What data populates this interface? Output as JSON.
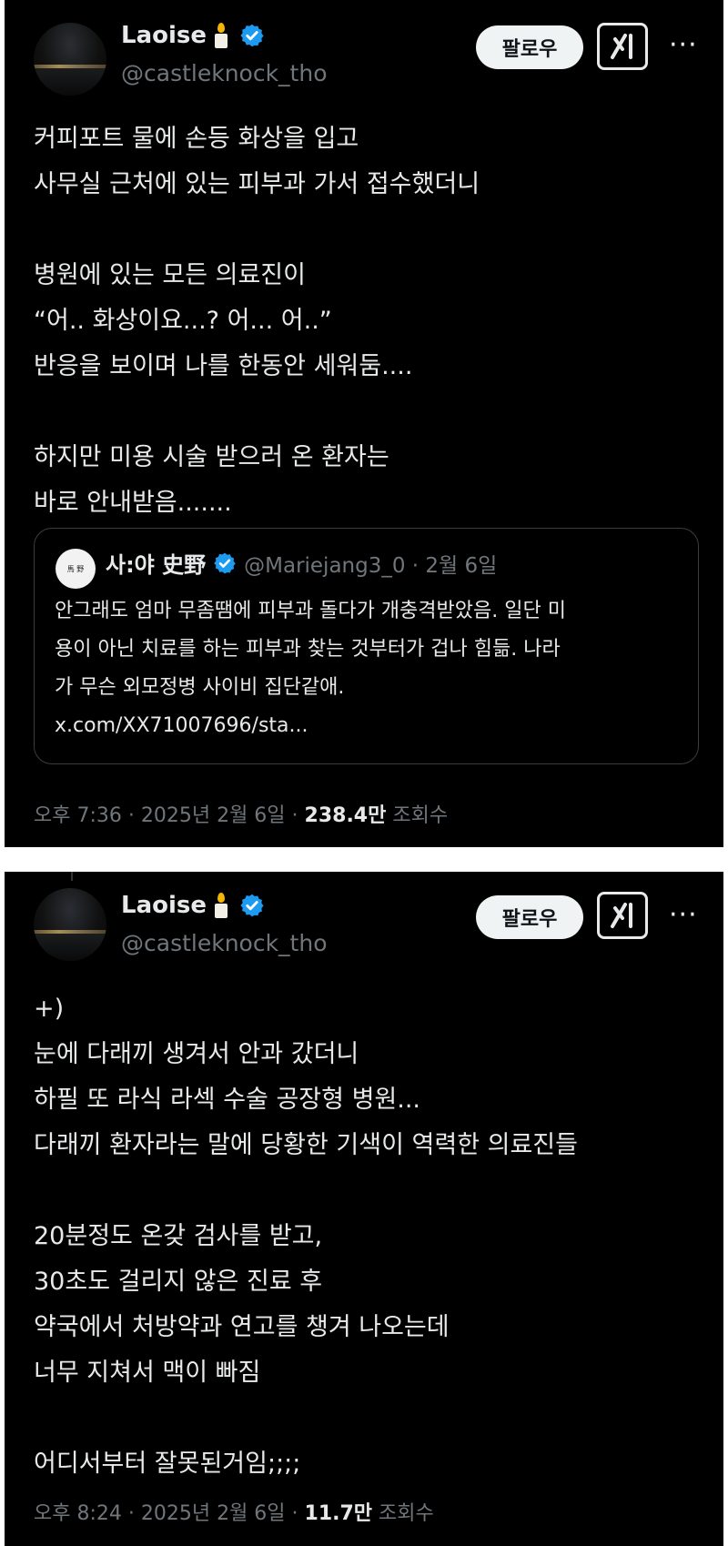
{
  "post1": {
    "author": "Laoise",
    "handle": "@castleknock_tho",
    "follow_label": "팔로우",
    "more_label": "···",
    "lines": [
      "커피포트 물에 손등 화상을 입고",
      "사무실 근처에 있는 피부과 가서 접수했더니",
      "",
      "병원에 있는 모든 의료진이",
      "“어.. 화상이요...? 어... 어..”",
      "반응을 보이며 나를 한동안 세워둠....",
      "",
      "하지만 미용 시술 받으러 온 환자는",
      "바로 안내받음......."
    ],
    "quote": {
      "avatar_text": "馬 野",
      "author": "사:야 史野",
      "handle_date": "@Mariejang3_0 · 2월 6일",
      "lines": [
        "안그래도 엄마 무좀땜에 피부과 돌다가 개충격받았음. 일단 미",
        "용이 아닌 치료를 하는 피부과 찾는 것부터가 겁나 힘듦. 나라",
        "가 무슨 외모정병 사이비 집단같애.",
        "x.com/XX71007696/sta..."
      ]
    },
    "time": "오후 7:36 · 2025년 2월 6일 · ",
    "views": "238.4만",
    "views_label": " 조회수"
  },
  "post2": {
    "author": "Laoise",
    "handle": "@castleknock_tho",
    "follow_label": "팔로우",
    "more_label": "···",
    "lines": [
      "+)",
      "눈에 다래끼 생겨서 안과 갔더니",
      "하필 또 라식 라섹 수술 공장형 병원...",
      "다래끼 환자라는 말에 당황한 기색이 역력한 의료진들",
      "",
      "20분정도 온갖 검사를 받고,",
      "30초도 걸리지 않은 진료 후",
      "약국에서 처방약과 연고를 챙겨 나오는데",
      "너무 지쳐서 맥이 빠짐",
      "",
      "어디서부터 잘못된거임;;;;"
    ],
    "time": "오후 8:24 · 2025년 2월 6일 · ",
    "views": "11.7만",
    "views_label": " 조회수"
  },
  "colors": {
    "background": "#000000",
    "text": "#e7e9ea",
    "muted": "#71767b",
    "verified": "#1d9bf0"
  }
}
